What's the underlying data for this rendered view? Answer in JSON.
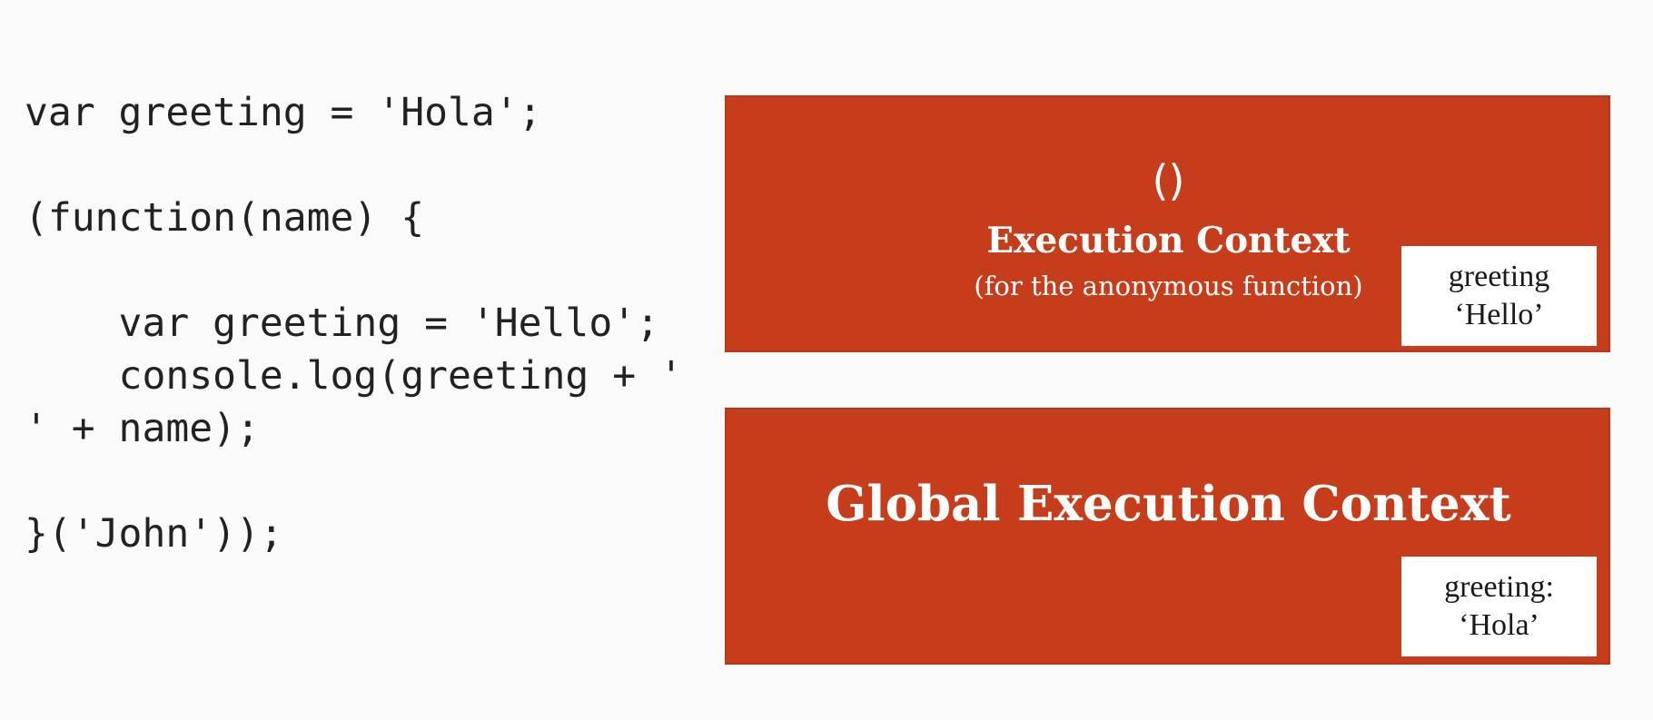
{
  "code": {
    "lines": [
      "var greeting = 'Hola';",
      "",
      "(function(name) {",
      "",
      "    var greeting = 'Hello';",
      "    console.log(greeting + '",
      "' + name);",
      "",
      "}('John'));"
    ]
  },
  "function_context": {
    "symbol": "()",
    "title": "Execution Context",
    "subtitle": "(for the anonymous function)",
    "variable": {
      "name": "greeting",
      "value": "‘Hello’"
    }
  },
  "global_context": {
    "title": "Global Execution Context",
    "variable": {
      "name": "greeting:",
      "value": "‘Hola’"
    }
  },
  "colors": {
    "box_fill": "#c63d1c",
    "box_text": "#ffffff",
    "card_fill": "#ffffff",
    "code_text": "#222222",
    "background": "#fafafa"
  }
}
